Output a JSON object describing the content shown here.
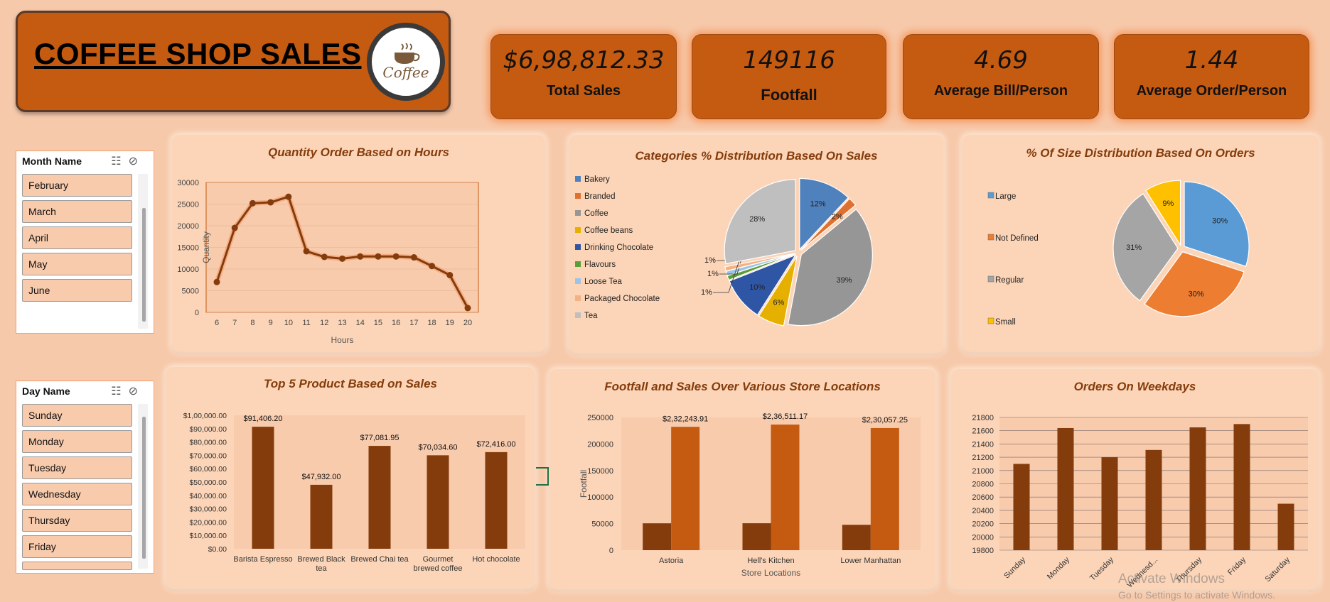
{
  "header": {
    "title": "COFFEE SHOP SALES",
    "logo_text": "Coffee"
  },
  "kpis": [
    {
      "value": "$6,98,812.33",
      "label": "Total Sales"
    },
    {
      "value": "149116",
      "label": "Footfall"
    },
    {
      "value": "4.69",
      "label": "Average Bill/Person"
    },
    {
      "value": "1.44",
      "label": "Average Order/Person"
    }
  ],
  "month_slicer": {
    "title": "Month Name",
    "items": [
      "February",
      "March",
      "April",
      "May",
      "June"
    ]
  },
  "day_slicer": {
    "title": "Day Name",
    "items": [
      "Sunday",
      "Monday",
      "Tuesday",
      "Wednesday",
      "Thursday",
      "Friday"
    ]
  },
  "chart_data": [
    {
      "type": "line",
      "title": "Quantity Order Based on Hours",
      "xlabel": "Hours",
      "ylabel": "Quantity",
      "x": [
        6,
        7,
        8,
        9,
        10,
        11,
        12,
        13,
        14,
        15,
        16,
        17,
        18,
        19,
        20
      ],
      "values": [
        7000,
        19500,
        25200,
        25400,
        26700,
        14100,
        12800,
        12400,
        12900,
        12900,
        12900,
        12700,
        10700,
        8600,
        1000
      ],
      "ylim": [
        0,
        30000
      ],
      "yticks": [
        0,
        5000,
        10000,
        15000,
        20000,
        25000,
        30000
      ],
      "color": "#843c0c"
    },
    {
      "type": "pie",
      "title": "Categories % Distribution Based On Sales",
      "categories": [
        "Bakery",
        "Branded",
        "Coffee",
        "Coffee beans",
        "Drinking Chocolate",
        "Flavours",
        "Loose Tea",
        "Packaged Chocolate",
        "Tea"
      ],
      "values": [
        12,
        2,
        39,
        6,
        10,
        1,
        1,
        1,
        28
      ],
      "labels": [
        "12%",
        "2%",
        "39%",
        "6%",
        "10%",
        "1%",
        "1%",
        "1%",
        "28%"
      ],
      "colors": [
        "#4f81bd",
        "#e07030",
        "#969696",
        "#e6b000",
        "#2f55a5",
        "#5a9e3a",
        "#9dc3e6",
        "#f4b183",
        "#bfbfbf"
      ],
      "legend": "left"
    },
    {
      "type": "pie",
      "title": "%  Of Size Distribution Based On Orders",
      "categories": [
        "Large",
        "Not Defined",
        "Regular",
        "Small"
      ],
      "values": [
        30,
        30,
        31,
        9
      ],
      "labels": [
        "30%",
        "30%",
        "31%",
        "9%"
      ],
      "colors": [
        "#5b9bd5",
        "#ed7d31",
        "#a5a5a5",
        "#ffc000"
      ],
      "legend": "left"
    },
    {
      "type": "bar",
      "title": "Top 5 Product Based on Sales",
      "categories": [
        "Barista Espresso",
        "Brewed Black tea",
        "Brewed Chai tea",
        "Gourmet brewed coffee",
        "Hot chocolate"
      ],
      "values": [
        91406.2,
        47932,
        77081.95,
        70034.6,
        72416
      ],
      "data_labels": [
        "$91,406.20",
        "$47,932.00",
        "$77,081.95",
        "$70,034.60",
        "$72,416.00"
      ],
      "ylim": [
        0,
        100000
      ],
      "yticks": [
        "$0.00",
        "$10,000.00",
        "$20,000.00",
        "$30,000.00",
        "$40,000.00",
        "$50,000.00",
        "$60,000.00",
        "$70,000.00",
        "$80,000.00",
        "$90,000.00",
        "$1,00,000.00"
      ],
      "color": "#843c0c"
    },
    {
      "type": "bar",
      "title": "Footfall and Sales Over Various Store Locations",
      "xlabel": "Store Locations",
      "ylabel": "Footfall",
      "categories": [
        "Astoria",
        "Hell's Kitchen",
        "Lower Manhattan"
      ],
      "series": [
        {
          "values": [
            50600,
            50700,
            47800
          ],
          "color": "#843c0c"
        },
        {
          "values": [
            232243.91,
            236511.17,
            230057.25
          ],
          "color": "#c55a11"
        }
      ],
      "data_labels": [
        "$2,32,243.91",
        "$2,36,511.17",
        "$2,30,057.25"
      ],
      "ylim": [
        0,
        250000
      ],
      "yticks": [
        0,
        50000,
        100000,
        150000,
        200000,
        250000
      ]
    },
    {
      "type": "bar",
      "title": "Orders On Weekdays",
      "categories": [
        "Sunday",
        "Monday",
        "Tuesday",
        "Wednesd...",
        "Thursday",
        "Friday",
        "Saturday"
      ],
      "values": [
        21100,
        21640,
        21200,
        21310,
        21650,
        21700,
        20500
      ],
      "ylim": [
        19800,
        21800
      ],
      "yticks": [
        19800,
        20000,
        20200,
        20400,
        20600,
        20800,
        21000,
        21200,
        21400,
        21600,
        21800
      ],
      "color": "#843c0c"
    }
  ],
  "watermark": {
    "line1": "Activate Windows",
    "line2": "Go to Settings to activate Windows."
  }
}
